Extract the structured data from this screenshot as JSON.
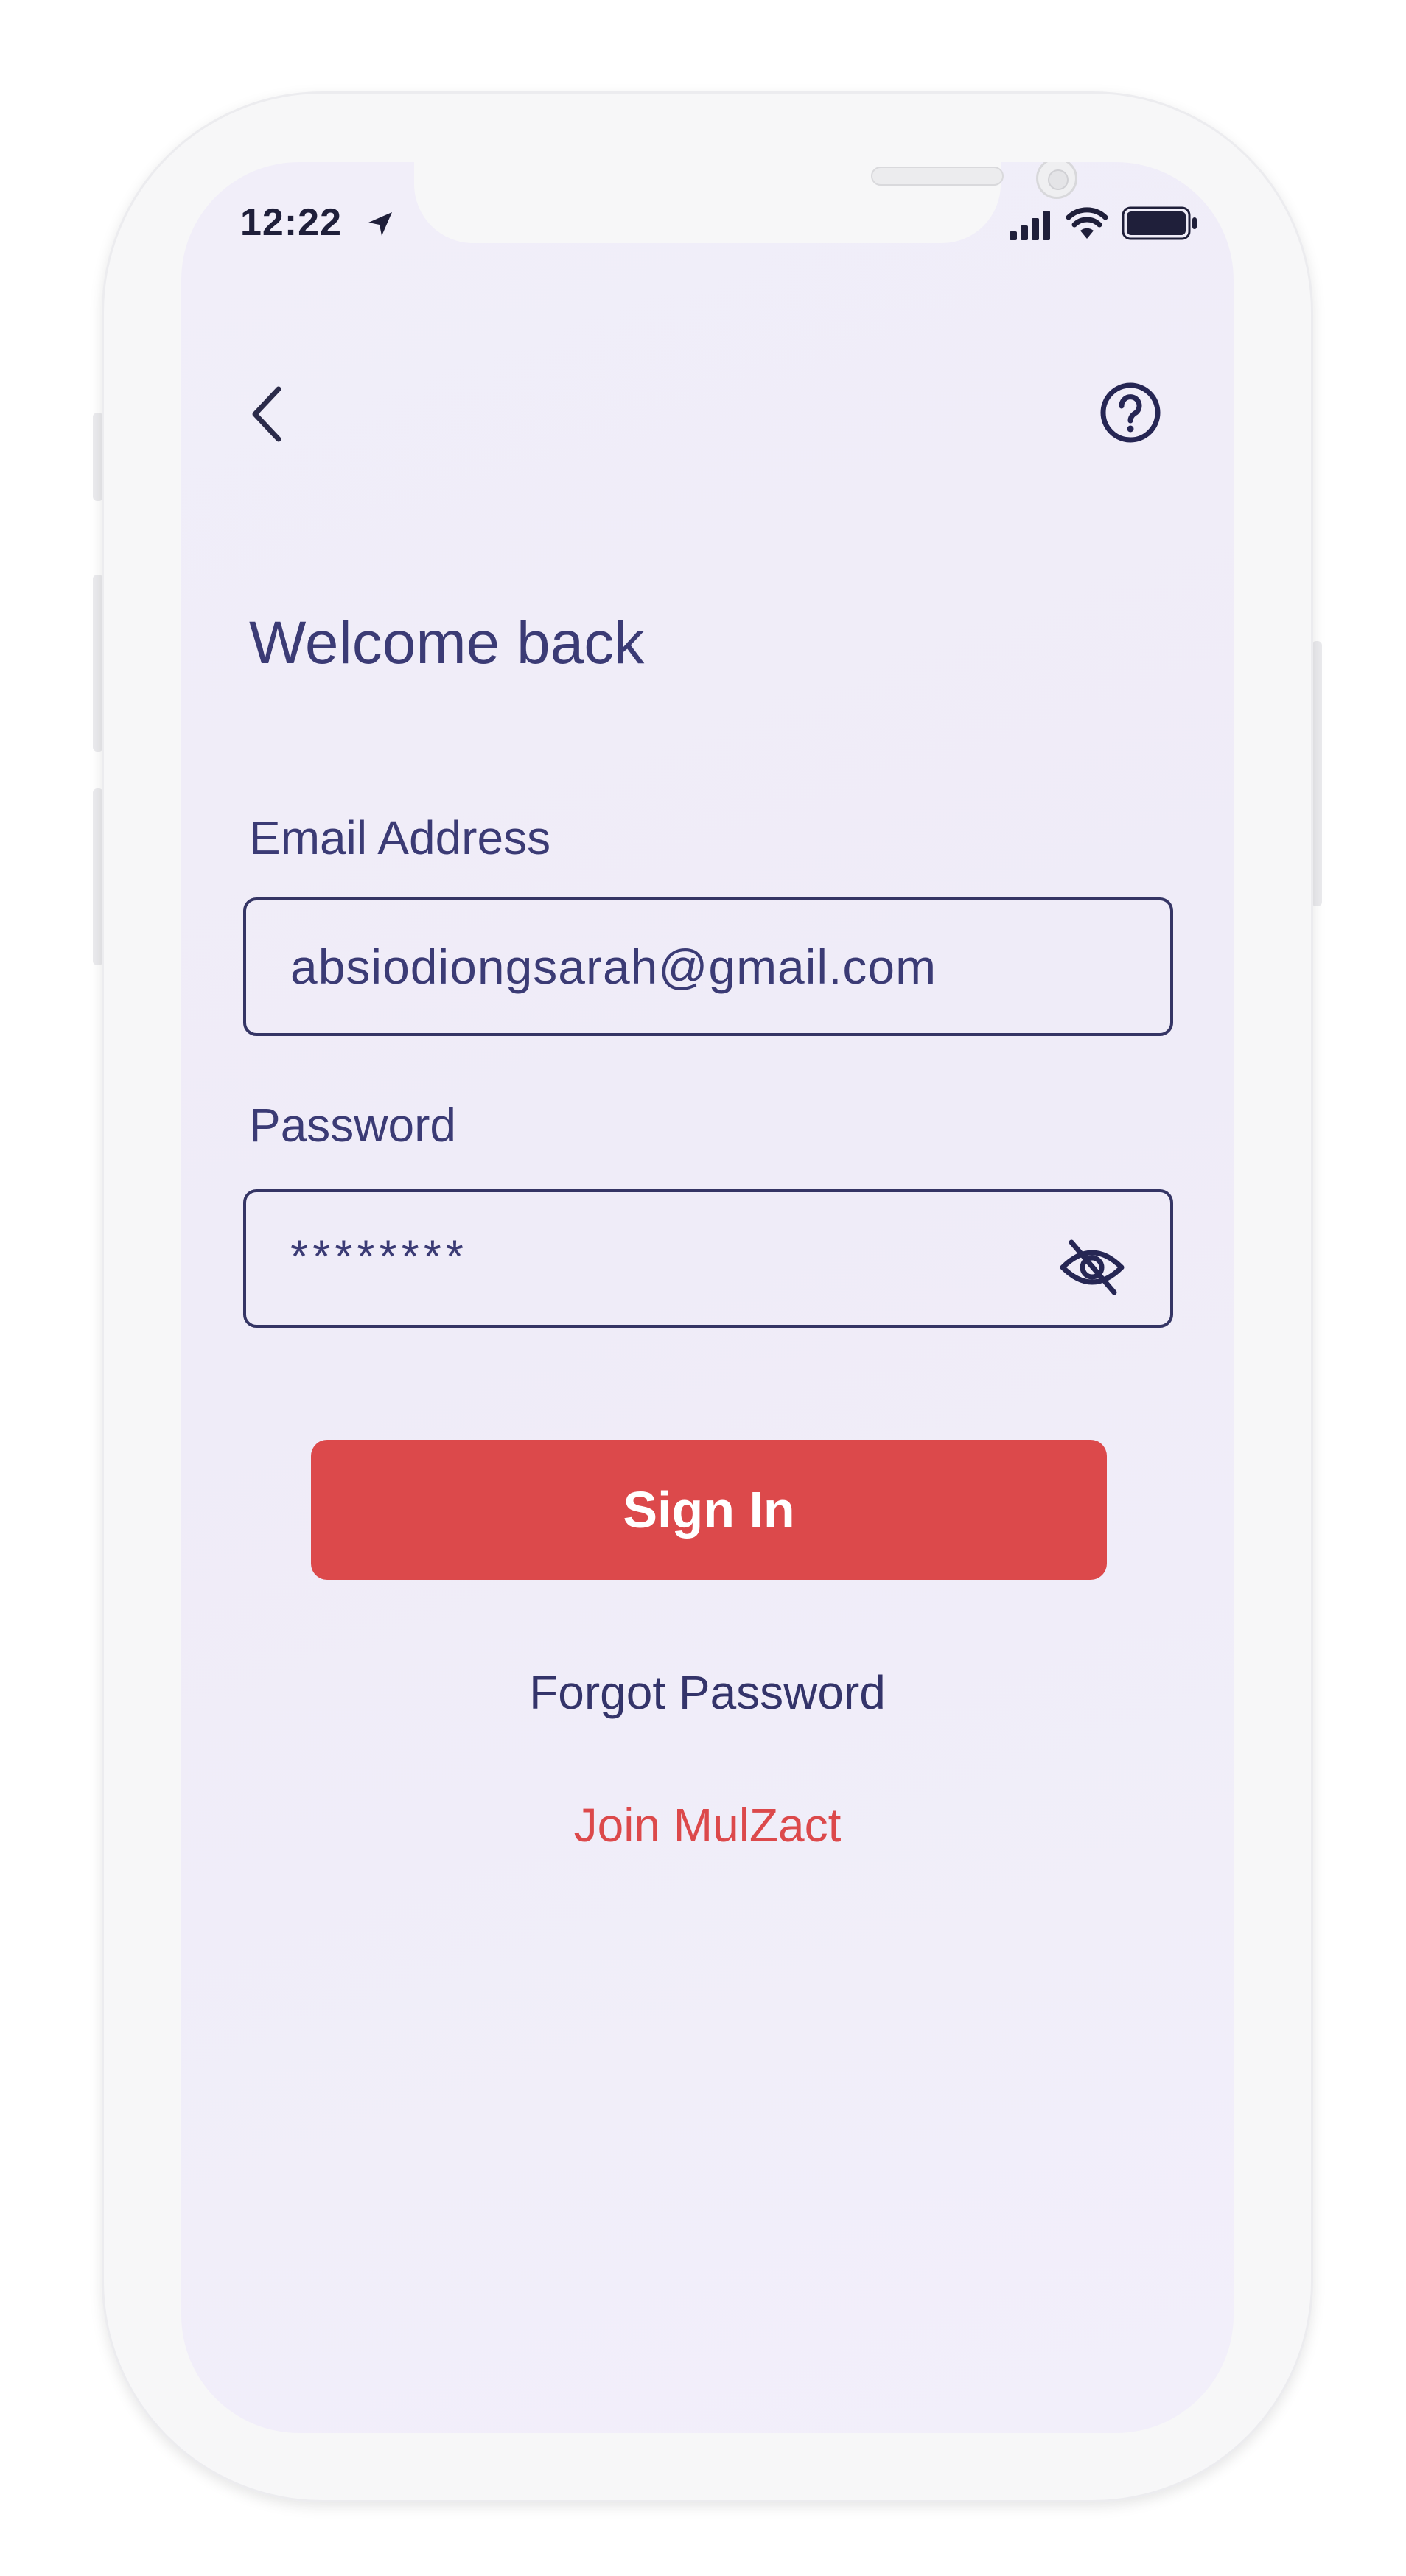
{
  "status_bar": {
    "time": "12:22",
    "icons": [
      "location-arrow-icon",
      "cellular-signal-icon",
      "wifi-icon",
      "battery-icon"
    ]
  },
  "nav": {
    "back_icon": "chevron-left-icon",
    "help_icon": "question-circle-icon"
  },
  "title": "Welcome back",
  "email": {
    "label": "Email Address",
    "value": "absiodiongsarah@gmail.com"
  },
  "password": {
    "label": "Password",
    "value": "********",
    "toggle_icon": "eye-slash-icon"
  },
  "signin_label": "Sign In",
  "forgot_label": "Forgot Password",
  "join_label": "Join MulZact",
  "colors": {
    "accent_red": "#dc494b",
    "primary_text": "#3b3b75",
    "background": "#f1eef9"
  }
}
